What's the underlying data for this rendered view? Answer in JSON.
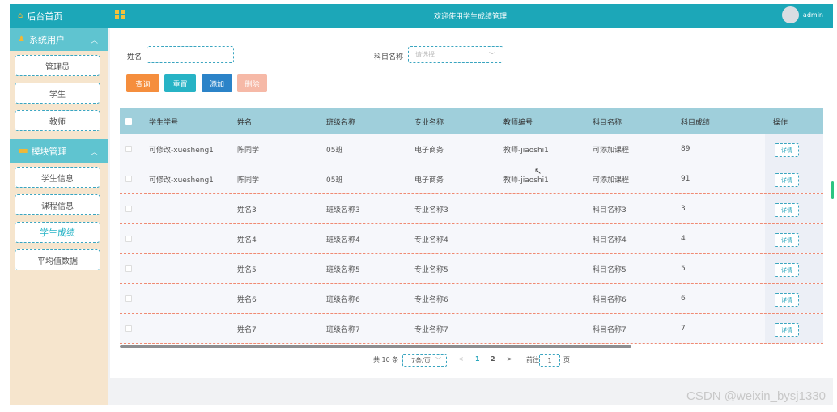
{
  "header": {
    "title": "欢迎使用学生成绩管理",
    "user": "admin"
  },
  "sidebar": {
    "home": "后台首页",
    "sections": [
      {
        "title": "系统用户",
        "items": [
          "管理员",
          "学生",
          "教师"
        ]
      },
      {
        "title": "模块管理",
        "items": [
          "学生信息",
          "课程信息",
          "学生成绩",
          "平均值数据"
        ]
      }
    ],
    "active_item": "学生成绩"
  },
  "search": {
    "name_label": "姓名",
    "name_value": "",
    "subject_label": "科目名称",
    "subject_placeholder": "请选择"
  },
  "buttons": {
    "query": "查询",
    "reset": "重置",
    "add": "添加",
    "delete": "删除"
  },
  "colors": {
    "query": "#f58e3d",
    "reset": "#27b3c5",
    "add": "#2b83c8",
    "delete": "#f6b9a7"
  },
  "table": {
    "columns": [
      "学生学号",
      "姓名",
      "班级名称",
      "专业名称",
      "教师编号",
      "科目名称",
      "科目成绩",
      "操作"
    ],
    "rows": [
      [
        "可修改-xuesheng1",
        "陈同学",
        "05班",
        "电子商务",
        "教师-jiaoshi1",
        "可添加课程",
        "89"
      ],
      [
        "可修改-xuesheng1",
        "陈同学",
        "05班",
        "电子商务",
        "教师-jiaoshi1",
        "可添加课程",
        "91"
      ],
      [
        "",
        "姓名3",
        "班级名称3",
        "专业名称3",
        "",
        "科目名称3",
        "3"
      ],
      [
        "",
        "姓名4",
        "班级名称4",
        "专业名称4",
        "",
        "科目名称4",
        "4"
      ],
      [
        "",
        "姓名5",
        "班级名称5",
        "专业名称5",
        "",
        "科目名称5",
        "5"
      ],
      [
        "",
        "姓名6",
        "班级名称6",
        "专业名称6",
        "",
        "科目名称6",
        "6"
      ],
      [
        "",
        "姓名7",
        "班级名称7",
        "专业名称7",
        "",
        "科目名称7",
        "7"
      ]
    ],
    "detail_label": "详情"
  },
  "pagination": {
    "total": "共 10 条",
    "page_size": "7条/页",
    "prev": "<",
    "pages": [
      "1",
      "2"
    ],
    "next": ">",
    "goto_label": "前往",
    "goto_value": "1",
    "page_suffix": "页"
  },
  "watermark": "CSDN @weixin_bysj1330"
}
